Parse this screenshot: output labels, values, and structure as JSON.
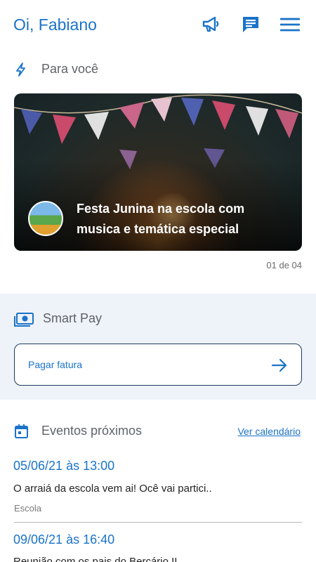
{
  "header": {
    "greeting": "Oi, Fabiano",
    "icons": [
      "megaphone-icon",
      "chat-icon",
      "menu-icon"
    ]
  },
  "for_you": {
    "title": "Para você",
    "icon": "lightning-icon",
    "carousel": {
      "caption": "Festa Junina na escola com musica e temática especial",
      "pager": "01 de 04"
    }
  },
  "smart_pay": {
    "title": "Smart Pay",
    "icon": "money-icon",
    "action_label": "Pagar fatura"
  },
  "events": {
    "title": "Eventos próximos",
    "icon": "calendar-icon",
    "link_label": "Ver calendário",
    "items": [
      {
        "date": "05/06/21 às 13:00",
        "description": "O arraiá da escola vem ai! Ocê vai partici..",
        "tag": "Escola"
      },
      {
        "date": "09/06/21 às 16:40",
        "description": "Reunião com os pais do Berçário II"
      }
    ]
  },
  "colors": {
    "accent": "#1a73c9",
    "band": "#eef2f9",
    "border": "#1f3a5f"
  }
}
